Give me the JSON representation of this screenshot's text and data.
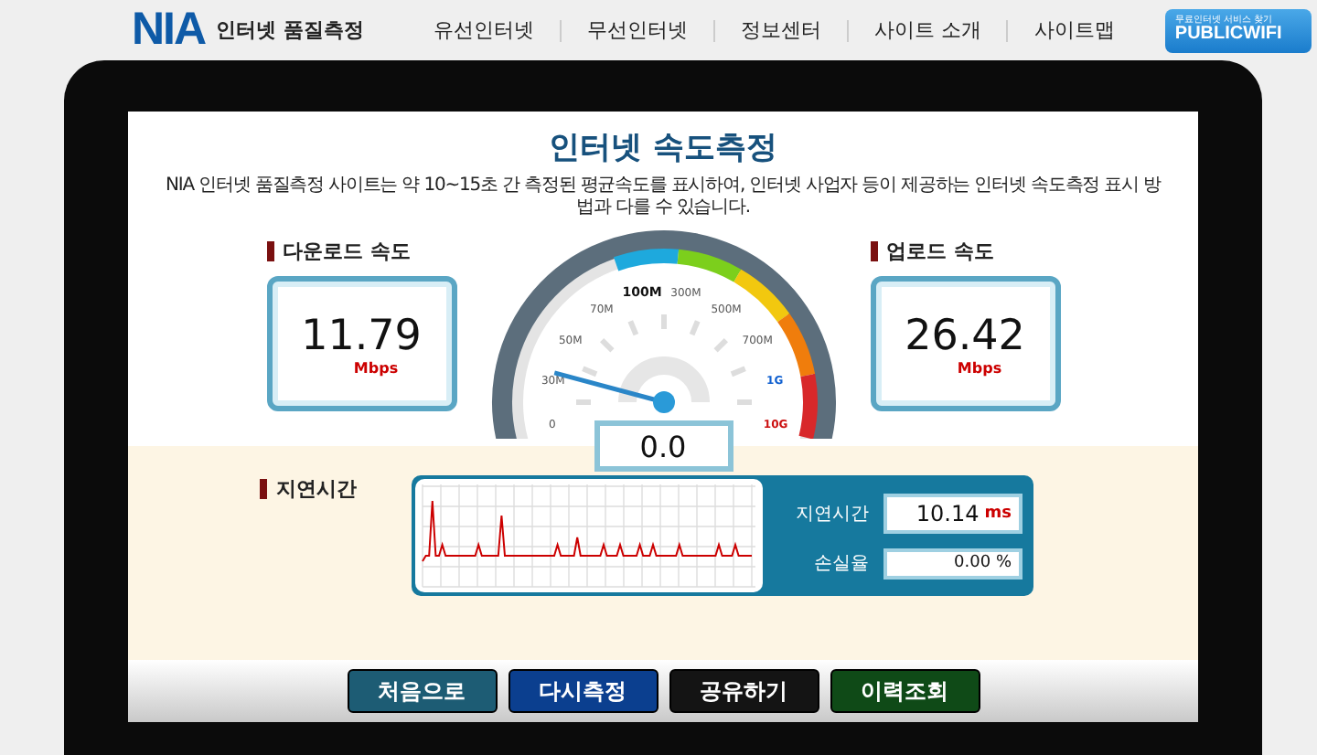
{
  "header": {
    "logo": "NIA",
    "logo_subtitle": "인터넷 품질측정",
    "nav": [
      "유선인터넷",
      "무선인터넷",
      "정보센터",
      "사이트 소개",
      "사이트맵"
    ],
    "wifi_badge": {
      "caption": "무료인터넷 서비스 찾기",
      "label": "PUBLICWIFI"
    }
  },
  "page": {
    "title": "인터넷 속도측정",
    "description": "NIA 인터넷 품질측정 사이트는 약 10~15초 간 측정된 평균속도를 표시하여, 인터넷 사업자 등이 제공하는 인터넷 속도측정 표시 방법과 다를 수 있습니다."
  },
  "download": {
    "label": "다운로드 속도",
    "value": "11.79",
    "unit": "Mbps"
  },
  "upload": {
    "label": "업로드 속도",
    "value": "26.42",
    "unit": "Mbps"
  },
  "gauge": {
    "scale": [
      "0",
      "30M",
      "50M",
      "70M",
      "100M",
      "300M",
      "500M",
      "700M",
      "1G",
      "10G"
    ],
    "reading": "0.0"
  },
  "latency": {
    "label": "지연시간",
    "fields": [
      {
        "label": "지연시간",
        "value": "10.14",
        "unit": "ms"
      },
      {
        "label": "손실율",
        "value": "0.00 %"
      }
    ]
  },
  "buttons": [
    {
      "label": "처음으로",
      "color": "#1d5c74"
    },
    {
      "label": "다시측정",
      "color": "#0b3f8f"
    },
    {
      "label": "공유하기",
      "color": "#141414"
    },
    {
      "label": "이력조회",
      "color": "#0f4a17"
    }
  ]
}
